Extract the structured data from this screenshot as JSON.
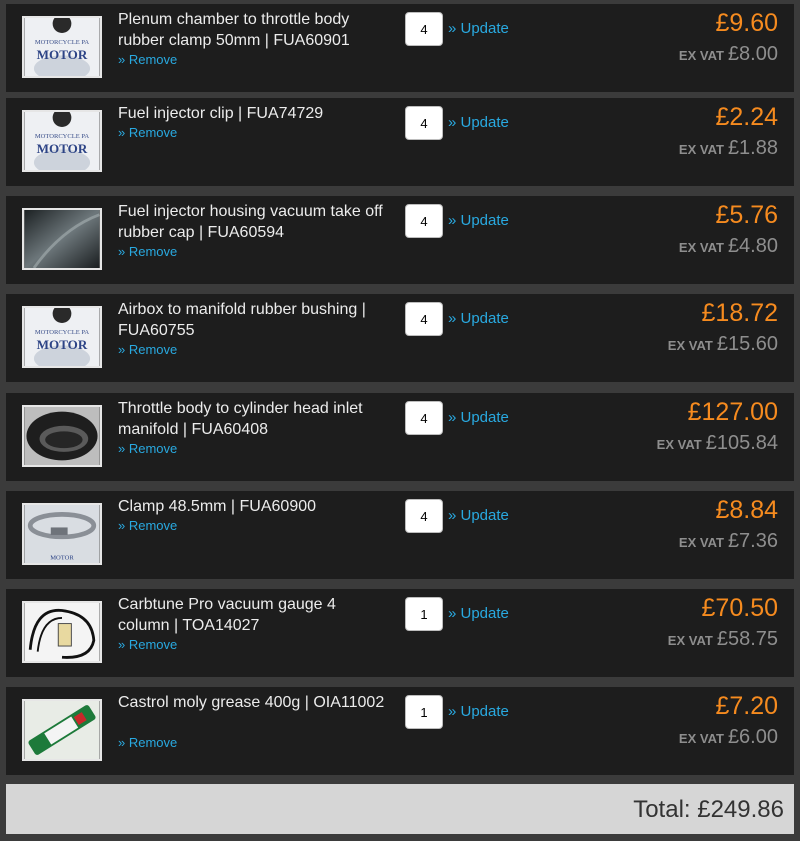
{
  "cart": {
    "update_label": "» Update",
    "remove_label": "» Remove",
    "ex_vat_label": "EX VAT",
    "items": [
      {
        "title": "Plenum chamber to throttle body rubber clamp 50mm | FUA60901",
        "qty": "4",
        "price": "£9.60",
        "ex_vat": "£8.00",
        "thumb": "motor-logo"
      },
      {
        "title": "Fuel injector clip | FUA74729",
        "qty": "4",
        "price": "£2.24",
        "ex_vat": "£1.88",
        "thumb": "motor-logo"
      },
      {
        "title": "Fuel injector housing vacuum take off rubber cap | FUA60594",
        "qty": "4",
        "price": "£5.76",
        "ex_vat": "£4.80",
        "thumb": "rubber-cap"
      },
      {
        "title": "Airbox to manifold rubber bushing | FUA60755",
        "qty": "4",
        "price": "£18.72",
        "ex_vat": "£15.60",
        "thumb": "motor-logo"
      },
      {
        "title": "Throttle body to cylinder head inlet manifold | FUA60408",
        "qty": "4",
        "price": "£127.00",
        "ex_vat": "£105.84",
        "thumb": "rubber-manifold"
      },
      {
        "title": "Clamp 48.5mm | FUA60900",
        "qty": "4",
        "price": "£8.84",
        "ex_vat": "£7.36",
        "thumb": "hose-clamp"
      },
      {
        "title": "Carbtune Pro vacuum gauge 4 column | TOA14027",
        "qty": "1",
        "price": "£70.50",
        "ex_vat": "£58.75",
        "thumb": "vacuum-gauge"
      },
      {
        "title": "Castrol moly grease 400g | OIA11002",
        "qty": "1",
        "price": "£7.20",
        "ex_vat": "£6.00",
        "thumb": "grease-tube"
      }
    ],
    "total": "Total: £249.86"
  }
}
